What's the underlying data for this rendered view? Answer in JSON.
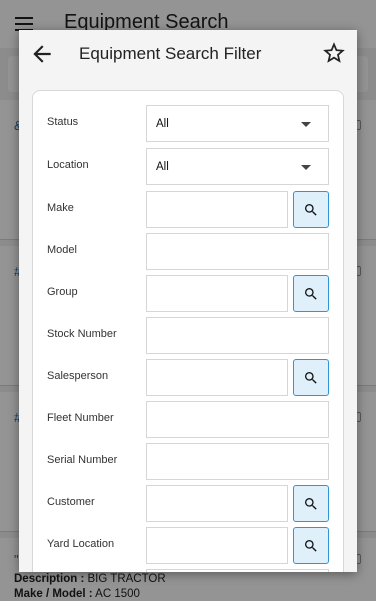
{
  "background": {
    "title": "Equipment Search",
    "cards": [
      {
        "hash": "&"
      },
      {
        "hash": "#"
      },
      {
        "hash": "#"
      },
      {
        "hash": "\""
      }
    ],
    "bottom": {
      "description_label": "Description :",
      "description_value": "BIG TRACTOR",
      "make_model_label": "Make / Model :",
      "make_model_value": "AC 1500"
    }
  },
  "modal": {
    "title": "Equipment Search Filter",
    "fields": [
      {
        "label": "Status",
        "type": "select",
        "value": "All"
      },
      {
        "label": "Location",
        "type": "select",
        "value": "All"
      },
      {
        "label": "Make",
        "type": "lookup",
        "value": ""
      },
      {
        "label": "Model",
        "type": "text",
        "value": ""
      },
      {
        "label": "Group",
        "type": "lookup",
        "value": ""
      },
      {
        "label": "Stock Number",
        "type": "text",
        "value": ""
      },
      {
        "label": "Salesperson",
        "type": "lookup",
        "value": ""
      },
      {
        "label": "Fleet Number",
        "type": "text",
        "value": ""
      },
      {
        "label": "Serial Number",
        "type": "text",
        "value": ""
      },
      {
        "label": "Customer",
        "type": "lookup",
        "value": ""
      },
      {
        "label": "Yard Location",
        "type": "lookup",
        "value": ""
      }
    ]
  },
  "colors": {
    "accent": "#2f95d3",
    "lookup_bg": "#dff0fb",
    "link": "#1f6fb2"
  },
  "icons": {
    "menu": "hamburger-menu-icon",
    "back": "arrow-left-icon",
    "favorite": "star-outline-icon",
    "lookup": "search-icon"
  }
}
